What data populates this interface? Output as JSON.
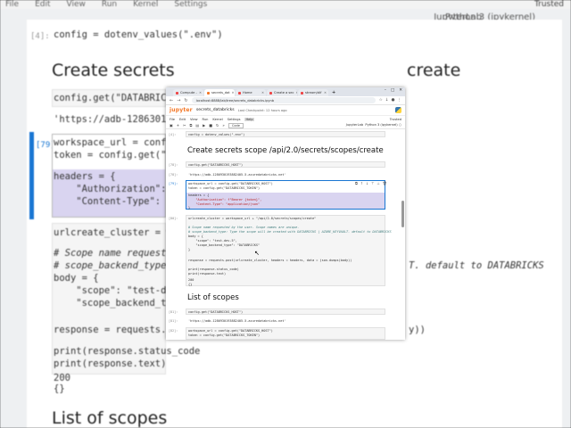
{
  "background": {
    "menu": [
      "File",
      "Edit",
      "View",
      "Run",
      "Kernel",
      "Settings"
    ],
    "topright": "Trusted",
    "kernel_label": "Python 3 (ipykernel)",
    "app_label": "JupyterLab",
    "prompt1": "[4]:",
    "code1": "config = dotenv_values(\".env\")",
    "heading1_left": "Create secrets",
    "heading1_right": "create",
    "code2": "config.get(\"DATABRICKS_HOS",
    "out2": "'https://adb-12863019388",
    "prompt3": "[79]:",
    "code3a": "workspace_url = config.get",
    "code3b": "token = config.get(\"DATAB",
    "code3c": "headers = {",
    "code3d": "    \"Authorization\": f\"Bea",
    "code3e": "    \"Content-Type\": \"appli",
    "code4": "urlcreate_cluster = worksp",
    "code5": "# Scope name requested by",
    "code6": "# scope_backend_type: type",
    "code6b": "T. default to DATABRICKS",
    "code7": "body = {",
    "code8": "    \"scope\": \"test-dev-5\",",
    "code9": "    \"scope_backend_type\": \"D",
    "code10": "response = requests.post(u",
    "code10b": "y))",
    "code11": "print(response.status_code",
    "code12": "print(response.text)",
    "out11": "200",
    "out12": "{}",
    "heading2": "List of scopes"
  },
  "browser": {
    "tabs": [
      {
        "label": "Compute -",
        "active": false
      },
      {
        "label": "secrets_dat",
        "active": true
      },
      {
        "label": "Home",
        "active": false
      },
      {
        "label": "Create a sec",
        "active": false
      },
      {
        "label": "stream/dif",
        "active": false
      }
    ],
    "url": "localhost:8888/lab/tree/secrets_databricks.ipynb",
    "window_controls": [
      "–",
      "□",
      "✕"
    ]
  },
  "jupyter": {
    "logo": "jupyter",
    "notebook_name": "secrets_databricks",
    "checkpoint": "Last Checkpoint: 12 hours ago",
    "menu": [
      "File",
      "Edit",
      "View",
      "Run",
      "Kernel",
      "Settings",
      "Help"
    ],
    "toolbar_cell_type": "Code",
    "app_label": "JupyterLab",
    "kernel": "Python 3 (ipykernel)",
    "trusted": "Trusted"
  },
  "cells": {
    "c0_prompt": "[4]:",
    "c0_code": "config = dotenv_values(\".env\")",
    "h1": "Create secrets scope /api/2.0/secrets/scopes/create",
    "c1_prompt": "[78]:",
    "c1_code": "config.get(\"DATABRICKS_HOST\")",
    "c1_out_prompt": "[78]:",
    "c1_out": "'https://adb-1286930193882405.5.azuredatabricks.net'",
    "c2_prompt": "[79]:",
    "c2_l1": "workspace_url = config.get(\"DATABRICKS_HOST\")",
    "c2_l2": "token = config.get(\"DATABRICKS_TOKEN\")",
    "c2_l3": "headers = {",
    "c2_l4": "    \"Authorization\": f\"Bearer {token}\",",
    "c2_l5": "    \"Content-Type\": \"application/json\"",
    "c2_l6": "}",
    "c3_prompt": "[80]:",
    "c3_l1": "urlcreate_cluster = workspace_url + \"/api/2.0/secrets/scopes/create\"",
    "c3_l2": "# Scope name requested by the user. Scope names are unique.",
    "c3_l3": "# scope_backend_type: Type the scope will be created with DATABRICKS | AZURE_KEYVAULT. default to DATABRICKS",
    "c3_l4": "body = {",
    "c3_l5": "    \"scope\": \"test-dev-5\",",
    "c3_l6": "    \"scope_backend_type\": \"DATABRICKS\"",
    "c3_l7": "}",
    "c3_l8": "response = requests.post(urlcreate_cluster, headers = headers, data = json.dumps(body))",
    "c3_l9": "print(response.status_code)",
    "c3_l10": "print(response.text)",
    "c3_out1": "200",
    "c3_out2": "{}",
    "h2": "List of scopes",
    "c4_prompt": "[81]:",
    "c4_code": "config.get(\"DATABRICKS_HOST\")",
    "c4_out_prompt": "[81]:",
    "c4_out": "'https://adb-1286930193882405.5.azuredatabricks.net'",
    "c5_prompt": "[82]:",
    "c5_l1": "workspace_url = config.get(\"DATABRICKS_HOST\")",
    "c5_l2": "token = config.get(\"DATABRICKS_TOKEN\")"
  }
}
